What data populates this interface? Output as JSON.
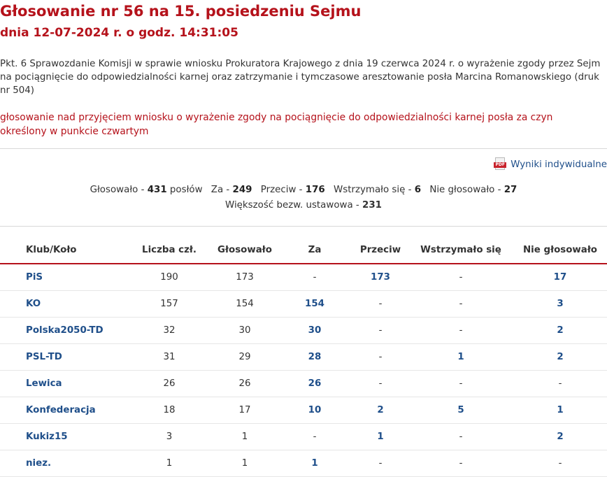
{
  "header": {
    "title": "Głosowanie nr 56 na 15. posiedzeniu Sejmu",
    "subtitle": "dnia 12-07-2024 r. o godz. 14:31:05"
  },
  "agenda": "Pkt. 6 Sprawozdanie Komisji w sprawie wniosku Prokuratora Krajowego z dnia 19 czerwca 2024 r. o wyrażenie zgody przez Sejm na pociągnięcie do odpowiedzialności karnej oraz zatrzymanie i tymczasowe aresztowanie posła Marcina Romanowskiego (druk nr 504)",
  "vote_subject": "głosowanie nad przyjęciem wniosku o wyrażenie zgody na pociągnięcie do odpowiedzialności karnej posła za czyn określony w punkcie czwartym",
  "pdf_link": {
    "label": "Wyniki indywidualne",
    "icon": "pdf-icon",
    "badge": "PDF"
  },
  "summary": {
    "voted_label": "Głosowało -",
    "voted": "431",
    "voted_suffix": "posłów",
    "for_label": "Za -",
    "for": "249",
    "against_label": "Przeciw -",
    "against": "176",
    "abstain_label": "Wstrzymało się -",
    "abstain": "6",
    "not_voted_label": "Nie głosowało -",
    "not_voted": "27",
    "majority_label": "Większość bezw. ustawowa -",
    "majority": "231"
  },
  "table": {
    "headers": [
      "Klub/Koło",
      "Liczba czł.",
      "Głosowało",
      "Za",
      "Przeciw",
      "Wstrzymało się",
      "Nie głosowało"
    ],
    "rows": [
      [
        "PiS",
        "190",
        "173",
        "-",
        "173",
        "-",
        "17"
      ],
      [
        "KO",
        "157",
        "154",
        "154",
        "-",
        "-",
        "3"
      ],
      [
        "Polska2050-TD",
        "32",
        "30",
        "30",
        "-",
        "-",
        "2"
      ],
      [
        "PSL-TD",
        "31",
        "29",
        "28",
        "-",
        "1",
        "2"
      ],
      [
        "Lewica",
        "26",
        "26",
        "26",
        "-",
        "-",
        "-"
      ],
      [
        "Konfederacja",
        "18",
        "17",
        "10",
        "2",
        "5",
        "1"
      ],
      [
        "Kukiz15",
        "3",
        "1",
        "-",
        "1",
        "-",
        "2"
      ],
      [
        "niez.",
        "1",
        "1",
        "1",
        "-",
        "-",
        "-"
      ]
    ]
  },
  "colors": {
    "accent": "#b5121b",
    "link": "#1f4f8a"
  }
}
